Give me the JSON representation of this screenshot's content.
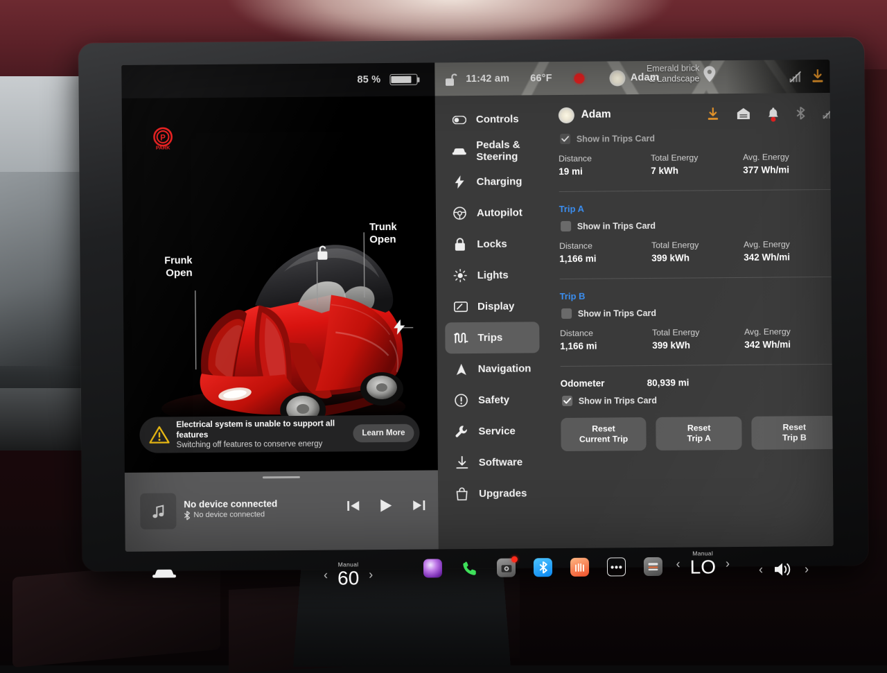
{
  "status_bar": {
    "battery_percent": "85 %",
    "lock_icon": "unlock-icon",
    "time": "11:42 am",
    "temperature": "66°F",
    "record_icon": "record-dot-icon",
    "profile_name": "Adam",
    "map_destination_line1": "Emerald brick",
    "map_destination_line2": "& Landscape",
    "map_pin_icon": "map-pin-icon",
    "signal_icon": "cellular-signal-off-icon",
    "download_icon": "software-update-download-icon"
  },
  "car_view": {
    "park_indicator": "PARK",
    "frunk_label": "Frunk",
    "frunk_state": "Open",
    "trunk_label": "Trunk",
    "trunk_state": "Open",
    "unlock_icon": "unlock-icon",
    "charge_port_icon": "charge-bolt-icon"
  },
  "toast": {
    "warning_icon": "warning-triangle-icon",
    "title": "Electrical system is unable to support all features",
    "subtitle": "Switching off features to conserve energy",
    "button_label": "Learn More"
  },
  "media": {
    "art_icon": "music-note-icon",
    "title": "No device connected",
    "subtitle": "No device connected",
    "bt_icon": "bluetooth-icon",
    "prev_icon": "skip-previous-icon",
    "play_icon": "play-icon",
    "next_icon": "skip-next-icon"
  },
  "settings": {
    "nav_items": [
      {
        "label": "Controls",
        "icon": "toggle-switch-icon",
        "active": false
      },
      {
        "label": "Pedals & Steering",
        "icon": "car-front-icon",
        "active": false
      },
      {
        "label": "Charging",
        "icon": "bolt-icon",
        "active": false
      },
      {
        "label": "Autopilot",
        "icon": "steering-wheel-icon",
        "active": false
      },
      {
        "label": "Locks",
        "icon": "lock-icon",
        "active": false
      },
      {
        "label": "Lights",
        "icon": "sun-lights-icon",
        "active": false
      },
      {
        "label": "Display",
        "icon": "display-icon",
        "active": false
      },
      {
        "label": "Trips",
        "icon": "trips-route-icon",
        "active": true
      },
      {
        "label": "Navigation",
        "icon": "navigation-arrow-icon",
        "active": false
      },
      {
        "label": "Safety",
        "icon": "alert-circle-icon",
        "active": false
      },
      {
        "label": "Service",
        "icon": "wrench-icon",
        "active": false
      },
      {
        "label": "Software",
        "icon": "download-icon",
        "active": false
      },
      {
        "label": "Upgrades",
        "icon": "shopping-bag-icon",
        "active": false
      }
    ],
    "header": {
      "profile_name": "Adam",
      "avatar_icon": "profile-avatar-icon",
      "icons": [
        "software-update-download-icon",
        "garage-home-icon",
        "notification-bell-icon",
        "bluetooth-icon",
        "cellular-signal-off-icon"
      ]
    },
    "trips": {
      "current": {
        "show_in_trips_card_label": "Show in Trips Card",
        "show_in_trips_card_checked": true,
        "show_in_trips_card_dimmed": true,
        "stats": [
          {
            "key": "Distance",
            "value": "19 mi"
          },
          {
            "key": "Total Energy",
            "value": "7 kWh"
          },
          {
            "key": "Avg. Energy",
            "value": "377 Wh/mi"
          }
        ]
      },
      "trip_a": {
        "title": "Trip A",
        "show_in_trips_card_label": "Show in Trips Card",
        "show_in_trips_card_checked": false,
        "stats": [
          {
            "key": "Distance",
            "value": "1,166 mi"
          },
          {
            "key": "Total Energy",
            "value": "399 kWh"
          },
          {
            "key": "Avg. Energy",
            "value": "342 Wh/mi"
          }
        ]
      },
      "trip_b": {
        "title": "Trip B",
        "show_in_trips_card_label": "Show in Trips Card",
        "show_in_trips_card_checked": false,
        "stats": [
          {
            "key": "Distance",
            "value": "1,166 mi"
          },
          {
            "key": "Total Energy",
            "value": "399 kWh"
          },
          {
            "key": "Avg. Energy",
            "value": "342 Wh/mi"
          }
        ]
      },
      "odometer": {
        "label": "Odometer",
        "value": "80,939 mi",
        "show_in_trips_card_label": "Show in Trips Card",
        "show_in_trips_card_checked": true
      },
      "buttons": [
        {
          "line1": "Reset",
          "line2": "Current Trip"
        },
        {
          "line1": "Reset",
          "line2": "Trip A"
        },
        {
          "line1": "Reset",
          "line2": "Trip B"
        }
      ]
    }
  },
  "taskbar": {
    "car_icon": "car-front-icon",
    "driver_climate": {
      "mode": "Manual",
      "value": "60",
      "left_arrow": "‹",
      "right_arrow": "›"
    },
    "passenger_climate": {
      "mode": "Manual",
      "value": "LO",
      "left_arrow": "‹",
      "right_arrow": "›"
    },
    "apps": [
      {
        "icon": "media-orb-icon",
        "badge": false
      },
      {
        "icon": "phone-icon",
        "badge": false
      },
      {
        "icon": "camera-dashcam-icon",
        "badge": true
      },
      {
        "icon": "bluetooth-app-icon",
        "badge": false
      },
      {
        "icon": "seat-heater-icon",
        "badge": false
      },
      {
        "icon": "more-dots-icon",
        "badge": false
      },
      {
        "icon": "wiper-defrost-icon",
        "badge": false
      }
    ],
    "volume": {
      "icon": "volume-icon",
      "left_arrow": "‹",
      "right_arrow": "›"
    }
  },
  "colors": {
    "panel_bg": "#3a3a3a",
    "nav_active": "#5e5e5e",
    "accent_blue": "#3b8ef0",
    "accent_orange": "#e8962a",
    "warning_yellow": "#f2c013",
    "alert_red": "#e02020",
    "media_bar": "#59595a"
  }
}
